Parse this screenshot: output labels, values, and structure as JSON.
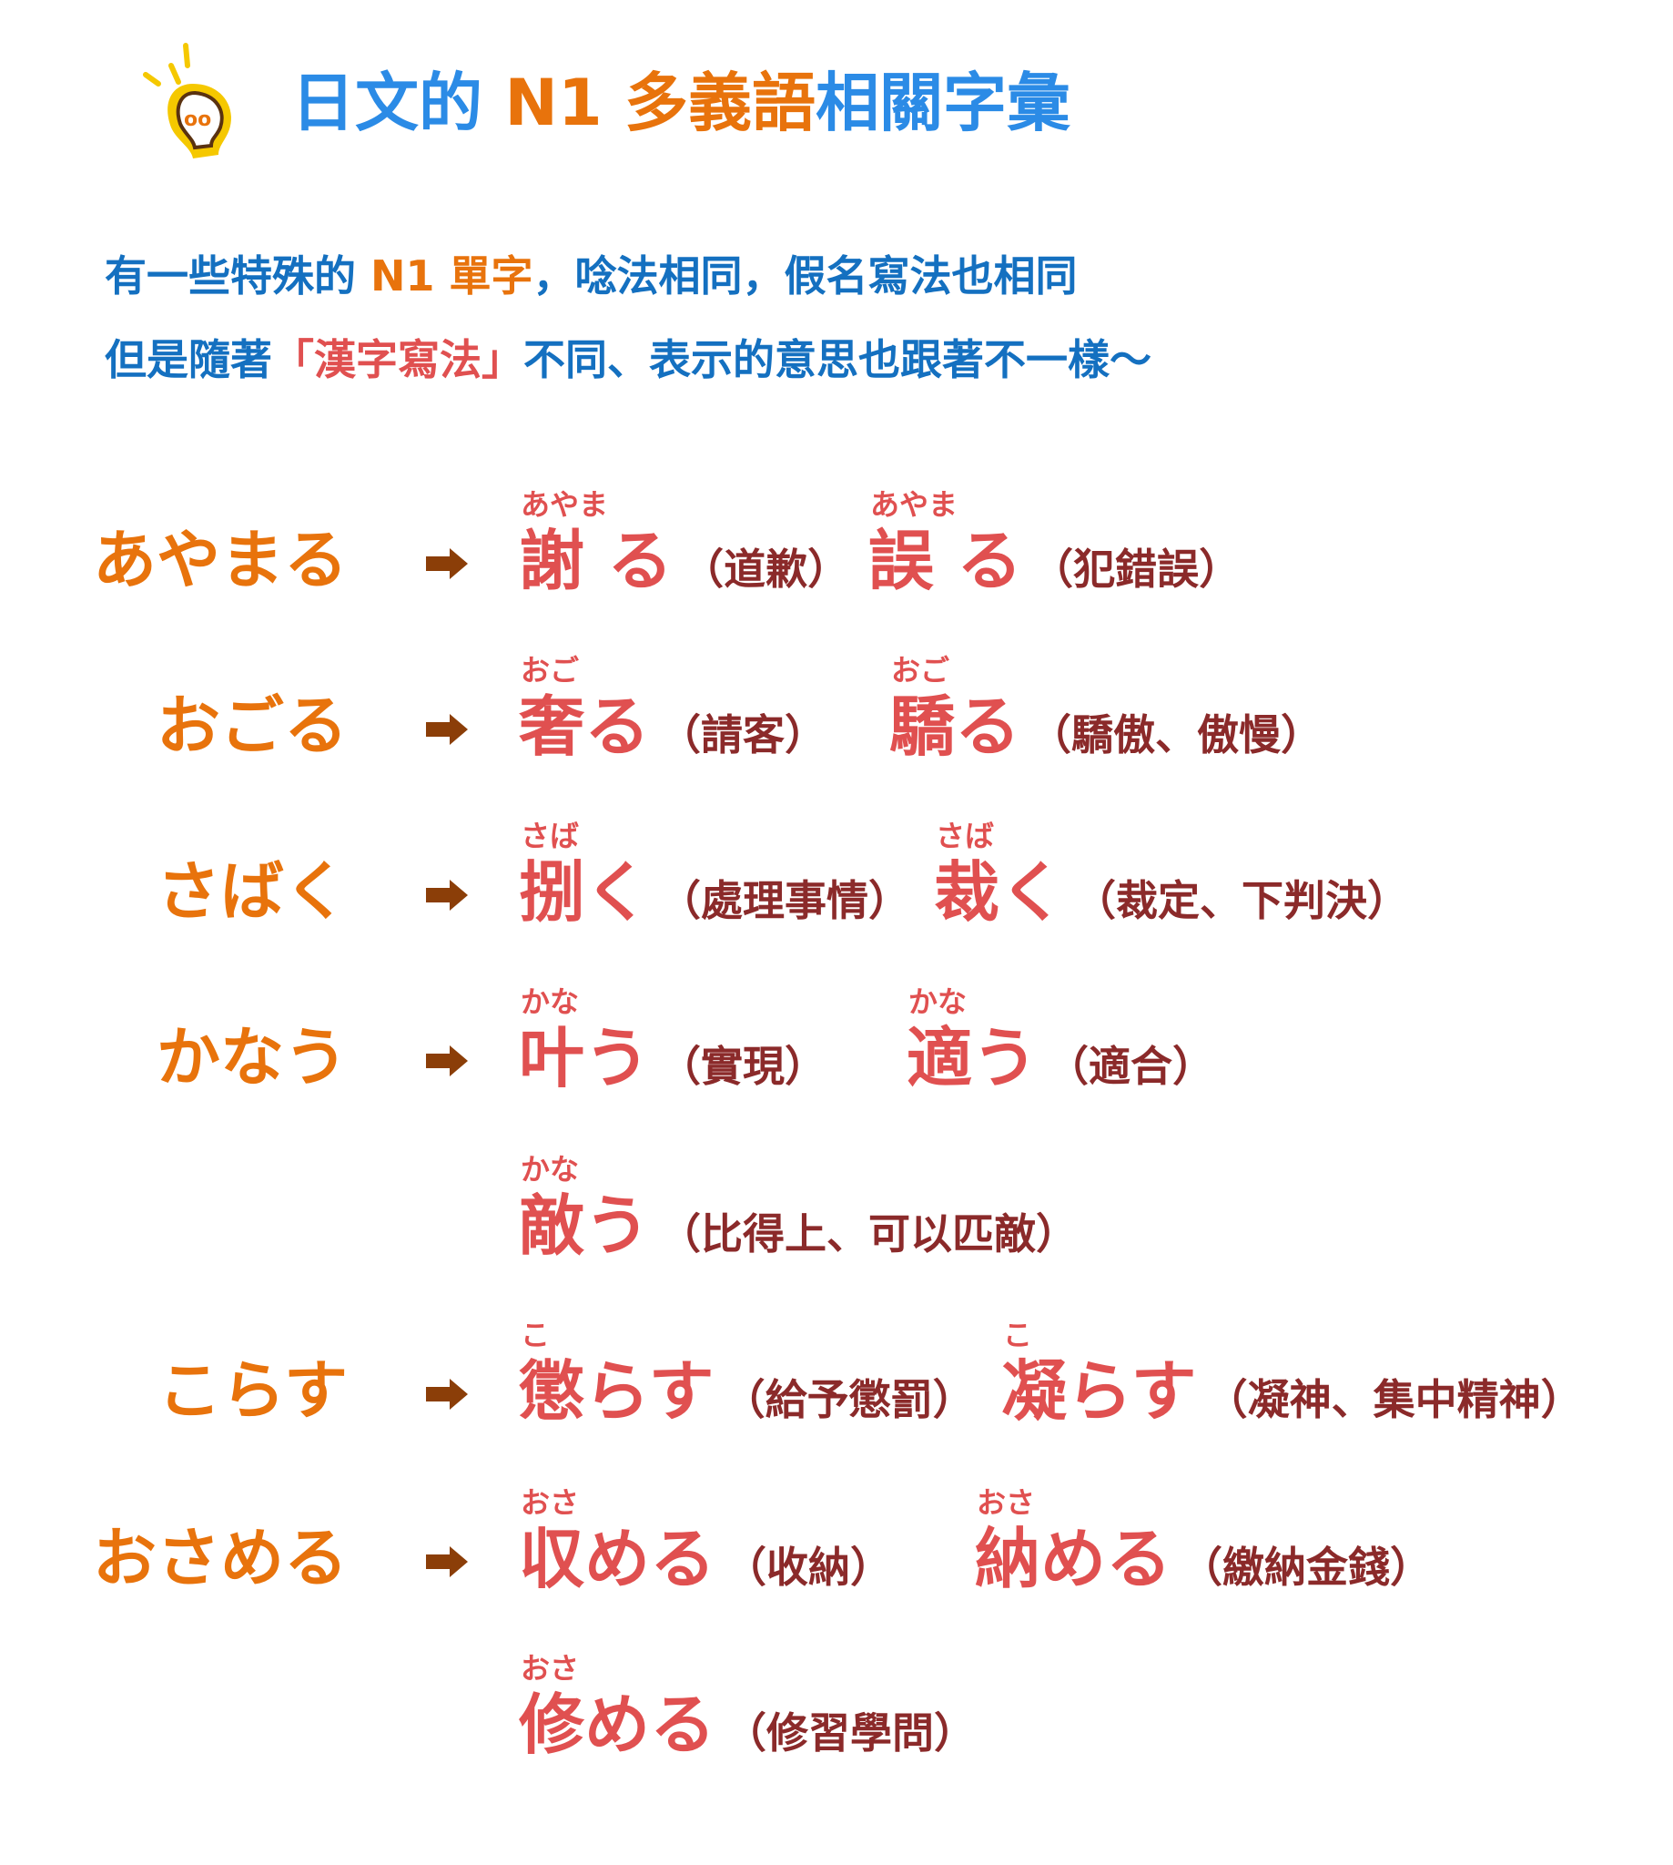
{
  "header": {
    "icon": "lightbulb-icon",
    "title_part1": "日文的",
    "title_part2": "N1 多義語",
    "title_part3": "相關字彙"
  },
  "intro": {
    "line1_a": "有一些特殊的",
    "line1_b": "N1 單字",
    "line1_c": "，唸法相同，假名寫法也相同",
    "line2_a": "但是隨著",
    "line2_b": "「漢字寫法」",
    "line2_c": "不同、表示的意思也跟著不一樣～"
  },
  "colors": {
    "title_blue": "#2b8be6",
    "accent_orange": "#e8730c",
    "text_blue": "#1470c0",
    "kanji_red": "#e05050",
    "meaning_brown": "#8b2a2a",
    "arrow_brown": "#8b3e08"
  },
  "rows": [
    {
      "kana": "あやまる",
      "entries": [
        {
          "ruby": "あやま",
          "word": "謝 る",
          "meaning": "（道歉）"
        },
        {
          "ruby": "あやま",
          "word": "誤 る",
          "meaning": "（犯錯誤）"
        }
      ]
    },
    {
      "kana": "おごる",
      "entries": [
        {
          "ruby": "おご",
          "word": "奢る",
          "meaning": "（請客）"
        },
        {
          "ruby": "おご",
          "word": "驕る",
          "meaning": "（驕傲、傲慢）"
        }
      ]
    },
    {
      "kana": "さばく",
      "entries": [
        {
          "ruby": "さば",
          "word": "捌く",
          "meaning": "（處理事情）"
        },
        {
          "ruby": "さば",
          "word": "裁く",
          "meaning": "（裁定、下判決）"
        }
      ]
    },
    {
      "kana": "かなう",
      "entries": [
        {
          "ruby": "かな",
          "word": "叶う",
          "meaning": "（實現）"
        },
        {
          "ruby": "かな",
          "word": "適う",
          "meaning": "（適合）"
        }
      ]
    },
    {
      "kana": "",
      "entries": [
        {
          "ruby": "かな",
          "word": "敵う",
          "meaning": "（比得上、可以匹敵）"
        }
      ]
    },
    {
      "kana": "こらす",
      "entries": [
        {
          "ruby": "こ",
          "word": "懲らす",
          "meaning": "（給予懲罰）"
        },
        {
          "ruby": "こ",
          "word": "凝らす",
          "meaning": "（凝神、集中精神）"
        }
      ]
    },
    {
      "kana": "おさめる",
      "entries": [
        {
          "ruby": "おさ",
          "word": "収める",
          "meaning": "（收納）"
        },
        {
          "ruby": "おさ",
          "word": "納める",
          "meaning": "（繳納金錢）"
        }
      ]
    },
    {
      "kana": "",
      "entries": [
        {
          "ruby": "おさ",
          "word": "修める",
          "meaning": "（修習學問）"
        }
      ]
    }
  ]
}
